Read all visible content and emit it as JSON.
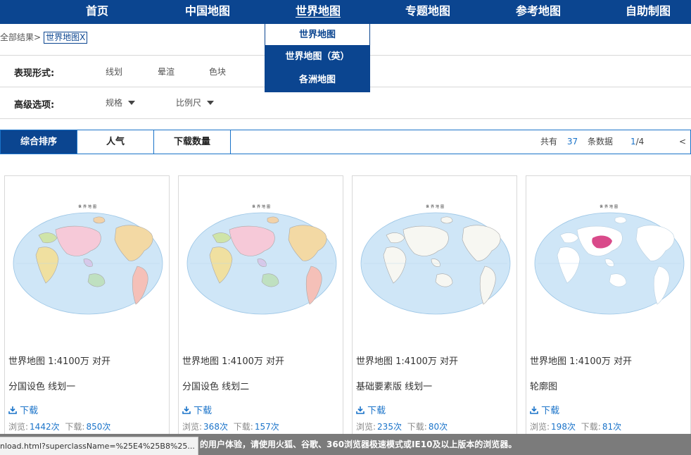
{
  "nav": {
    "items": [
      "首页",
      "中国地图",
      "世界地图",
      "专题地图",
      "参考地图",
      "自助制图"
    ],
    "active": "世界地图",
    "dropdown": [
      "世界地图",
      "世界地图（英）",
      "各洲地图"
    ]
  },
  "breadcrumb": {
    "root": "全部结果>",
    "tag": "世界地图X"
  },
  "filters": {
    "style_label": "表现形式:",
    "style_options": [
      "线划",
      "晕渲",
      "色块"
    ],
    "advanced_label": "高级选项:",
    "advanced_options": [
      "规格",
      "比例尺"
    ]
  },
  "sort": {
    "tabs": [
      "综合排序",
      "人气",
      "下载数量"
    ],
    "total_prefix": "共有",
    "total": "37",
    "total_suffix": "条数据",
    "page_current": "1",
    "page_total": "/4",
    "prev": "<"
  },
  "cards": [
    {
      "map_heading": "世界地图",
      "line1": "世界地图 1:4100万 对开",
      "line2": "分国设色 线划一",
      "download": "下载",
      "views_label": "浏览:",
      "views": "1442次",
      "downloads_label": "下载:",
      "downloads": "850次",
      "style": "political"
    },
    {
      "map_heading": "世界地图",
      "line1": "世界地图 1:4100万 对开",
      "line2": "分国设色 线划二",
      "download": "下载",
      "views_label": "浏览:",
      "views": "368次",
      "downloads_label": "下载:",
      "downloads": "157次",
      "style": "political"
    },
    {
      "map_heading": "世界地图",
      "line1": "世界地图 1:4100万 对开",
      "line2": "基础要素版 线划一",
      "download": "下载",
      "views_label": "浏览:",
      "views": "235次",
      "downloads_label": "下载:",
      "downloads": "80次",
      "style": "basic"
    },
    {
      "map_heading": "世界地图",
      "line1": "世界地图 1:4100万 对开",
      "line2": "轮廓图",
      "download": "下载",
      "views_label": "浏览:",
      "views": "198次",
      "downloads_label": "下载:",
      "downloads": "81次",
      "style": "outline"
    }
  ],
  "status": {
    "url": "nload.html?superclassName=%25E4%25B8%25...",
    "warning": "的用户体验，请使用火狐、谷歌、360浏览器极速模式或IE10及以上版本的浏览器。"
  },
  "colors": {
    "nav_bg": "#0b4590",
    "accent": "#1a73c9",
    "ocean": "#cfe6f7",
    "china_highlight": "#d94a8a"
  }
}
